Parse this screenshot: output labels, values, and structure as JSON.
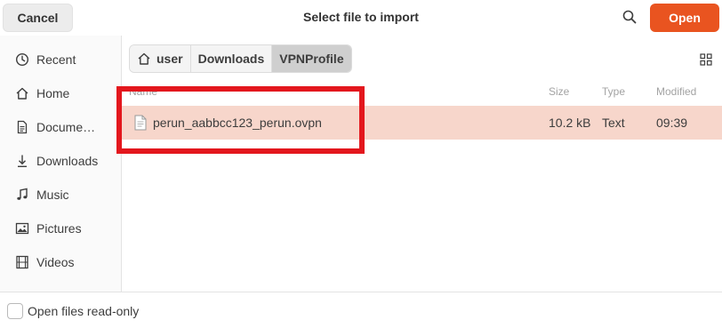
{
  "header": {
    "cancel_label": "Cancel",
    "title": "Select file to import",
    "open_label": "Open",
    "accent_color": "#e95420"
  },
  "sidebar": {
    "items": [
      {
        "label": "Recent",
        "icon": "clock-icon"
      },
      {
        "label": "Home",
        "icon": "home-icon"
      },
      {
        "label": "Docume…",
        "icon": "document-icon"
      },
      {
        "label": "Downloads",
        "icon": "download-icon"
      },
      {
        "label": "Music",
        "icon": "music-note-icon"
      },
      {
        "label": "Pictures",
        "icon": "picture-icon"
      },
      {
        "label": "Videos",
        "icon": "film-icon"
      }
    ]
  },
  "pathbar": {
    "crumbs": [
      "user",
      "Downloads",
      "VPNProfile"
    ]
  },
  "columns": {
    "name": "Name",
    "size": "Size",
    "type": "Type",
    "modified": "Modified"
  },
  "files": [
    {
      "name": "perun_aabbcc123_perun.ovpn",
      "size": "10.2 kB",
      "type": "Text",
      "modified": "09:39"
    }
  ],
  "footer": {
    "readonly_label": "Open files read-only"
  },
  "highlight_color": "#e3171d"
}
